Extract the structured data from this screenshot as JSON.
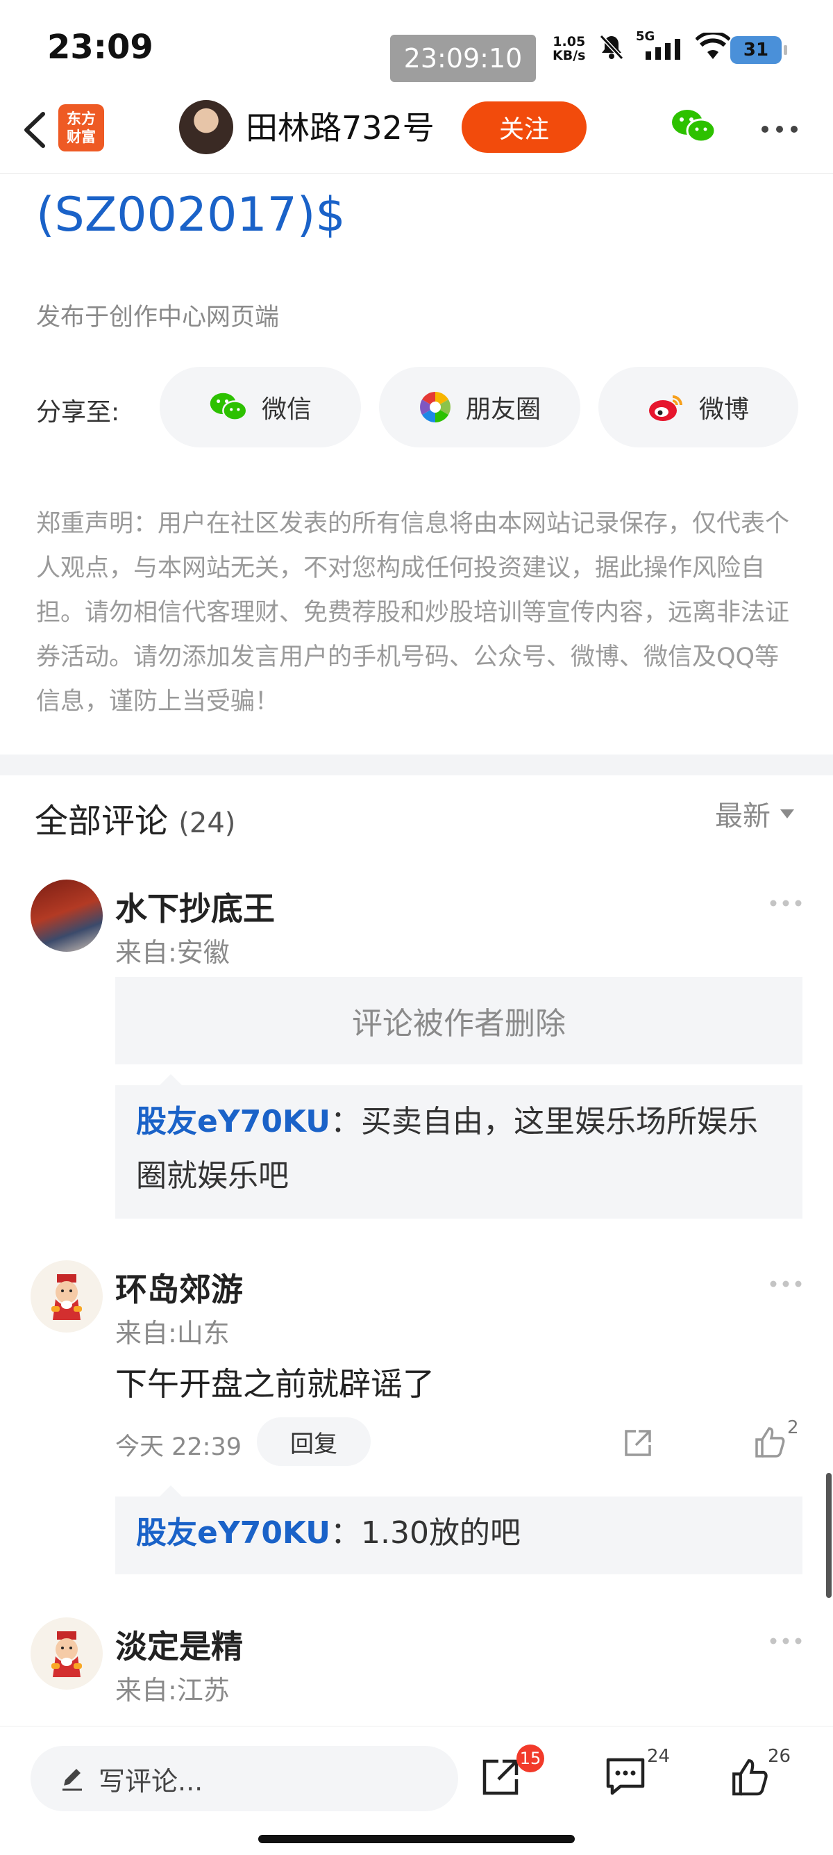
{
  "status_bar": {
    "time": "23:09",
    "clock_overlay": "23:09:10",
    "net_speed_value": "1.05",
    "net_speed_unit": "KB/s",
    "network": "5G",
    "battery": "31"
  },
  "header": {
    "logo_line1": "东方",
    "logo_line2": "财富",
    "author": "田林路732号",
    "follow_label": "关注"
  },
  "post": {
    "stock_tag": "(SZ002017)$",
    "published_from": "发布于创作中心网页端"
  },
  "share": {
    "label": "分享至:",
    "wechat": "微信",
    "moments": "朋友圈",
    "weibo": "微博"
  },
  "disclaimer": "郑重声明：用户在社区发表的所有信息将由本网站记录保存，仅代表个人观点，与本网站无关，不对您构成任何投资建议，据此操作风险自担。请勿相信代客理财、免费荐股和炒股培训等宣传内容，远离非法证券活动。请勿添加发言用户的手机号码、公众号、微博、微信及QQ等信息，谨防上当受骗！",
  "comments": {
    "title": "全部评论",
    "count": "(24)",
    "sort_label": "最新",
    "items": [
      {
        "name": "水下抄底王",
        "from": "来自:安徽",
        "deleted_text": "评论被作者删除",
        "reply_user": "股友eY70KU",
        "reply_text": "：买卖自由，这里娱乐场所娱乐圈就娱乐吧"
      },
      {
        "name": "环岛郊游",
        "from": "来自:山东",
        "text": "下午开盘之前就辟谣了",
        "time": "今天 22:39",
        "reply_btn": "回复",
        "likes": "2",
        "reply_user": "股友eY70KU",
        "reply_text": "：1.30放的吧"
      },
      {
        "name": "淡定是精",
        "from": "来自:江苏"
      }
    ]
  },
  "bottom": {
    "write_placeholder": "写评论...",
    "share_badge": "15",
    "comment_count": "24",
    "like_count": "26"
  },
  "colors": {
    "accent_orange": "#f24b0c",
    "link_blue": "#1a62c8",
    "wechat_green": "#2dc100",
    "weibo_red": "#e6162d"
  }
}
